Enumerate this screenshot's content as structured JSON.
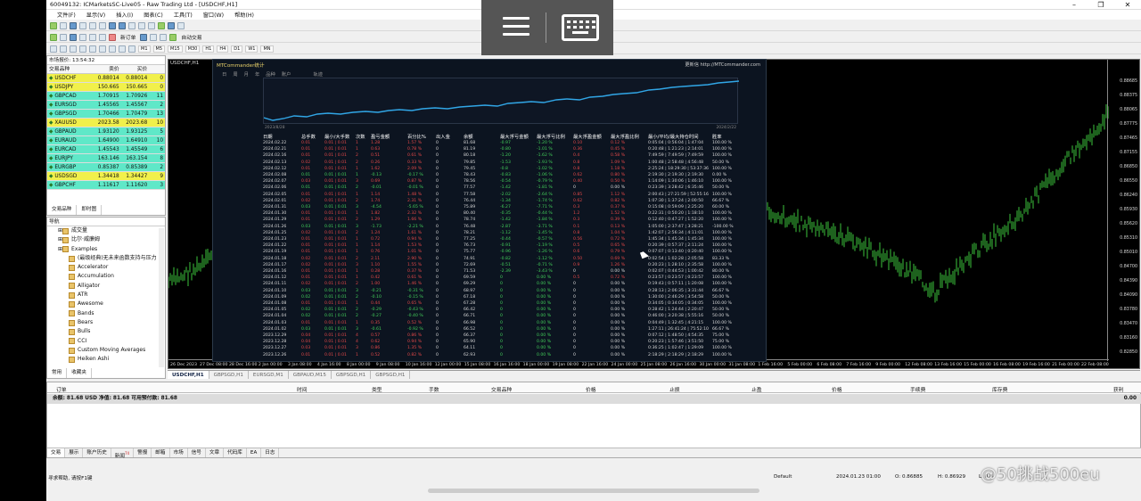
{
  "window": {
    "title": "60049132: ICMarketsSC-Live05 - Raw Trading Ltd - [USDCHF,H1]",
    "controls": [
      "–",
      "❐",
      "✕"
    ]
  },
  "menu": [
    "文件(F)",
    "显示(V)",
    "插入(I)",
    "图表(C)",
    "工具(T)",
    "窗口(W)",
    "帮助(H)"
  ],
  "toolbar": {
    "new_order": "新订单",
    "auto_trading": "自动交易",
    "timeframes": [
      "M1",
      "M5",
      "M15",
      "M30",
      "H1",
      "H4",
      "D1",
      "W1",
      "MN"
    ]
  },
  "market_watch": {
    "header": "市场报价: 13:54:32",
    "columns": [
      "交易品种",
      "卖价",
      "买价",
      ""
    ],
    "rows": [
      {
        "symbol": "USDCHF",
        "bid": "0.88014",
        "ask": "0.88014",
        "spread": "0",
        "color": "#f1f04b"
      },
      {
        "symbol": "USDJPY",
        "bid": "150.665",
        "ask": "150.665",
        "spread": "0",
        "color": "#f1f04b"
      },
      {
        "symbol": "GBPCAD",
        "bid": "1.70915",
        "ask": "1.70926",
        "spread": "11",
        "color": "#5fe8c8"
      },
      {
        "symbol": "EURSGD",
        "bid": "1.45565",
        "ask": "1.45567",
        "spread": "2",
        "color": "#5fe8c8"
      },
      {
        "symbol": "GBPSGD",
        "bid": "1.70466",
        "ask": "1.70479",
        "spread": "13",
        "color": "#5fe8c8"
      },
      {
        "symbol": "XAUUSD",
        "bid": "2023.58",
        "ask": "2023.68",
        "spread": "10",
        "color": "#f1f04b"
      },
      {
        "symbol": "GBPAUD",
        "bid": "1.93120",
        "ask": "1.93125",
        "spread": "5",
        "color": "#5fe8c8"
      },
      {
        "symbol": "EURAUD",
        "bid": "1.64900",
        "ask": "1.64910",
        "spread": "10",
        "color": "#5fe8c8"
      },
      {
        "symbol": "EURCAD",
        "bid": "1.45543",
        "ask": "1.45549",
        "spread": "6",
        "color": "#5fe8c8"
      },
      {
        "symbol": "EURJPY",
        "bid": "163.146",
        "ask": "163.154",
        "spread": "8",
        "color": "#5fe8c8"
      },
      {
        "symbol": "EURGBP",
        "bid": "0.85387",
        "ask": "0.85389",
        "spread": "2",
        "color": "#5fe8c8"
      },
      {
        "symbol": "USDSGD",
        "bid": "1.34418",
        "ask": "1.34427",
        "spread": "9",
        "color": "#f1f04b"
      },
      {
        "symbol": "GBPCHF",
        "bid": "1.11617",
        "ask": "1.11620",
        "spread": "3",
        "color": "#5fe8c8"
      }
    ],
    "tabs": [
      "交易品种",
      "即时图"
    ]
  },
  "navigator": {
    "header": "导航",
    "items": [
      "成交量",
      "比尔·威廉姆",
      "Examples",
      "(最级经典)无未来函数支持与压力",
      "Accelerator",
      "Accumulation",
      "Alligator",
      "ATR",
      "Awesome",
      "Bands",
      "Bears",
      "Bulls",
      "CCI",
      "Custom Moving Averages",
      "Heiken Ashi"
    ],
    "tabs": [
      "常用",
      "收藏夹"
    ]
  },
  "chart": {
    "tag": "USDCHF,H1",
    "y_labels": [
      "0.88685",
      "0.88375",
      "0.88065",
      "0.87775",
      "0.87465",
      "0.87155",
      "0.86850",
      "0.86550",
      "0.86240",
      "0.85930",
      "0.85620",
      "0.85310",
      "0.85010",
      "0.84700",
      "0.84390",
      "0.84090",
      "0.83780",
      "0.83470",
      "0.83160",
      "0.82850"
    ],
    "x_labels": [
      "26 Dec 2023",
      "27 Dec 08:00",
      "28 Dec 16:00",
      "2 Jan 00:00",
      "3 Jan 08:00",
      "4 Jan 16:00",
      "8 Jan 00:00",
      "9 Jan 08:00",
      "10 Jan 16:00",
      "12 Jan 00:00",
      "15 Jan 08:00",
      "16 Jan 16:00",
      "18 Jan 00:00",
      "19 Jan 08:00",
      "22 Jan 16:00",
      "24 Jan 00:00",
      "25 Jan 08:00",
      "26 Jan 16:00",
      "30 Jan 00:00",
      "31 Jan 08:00",
      "1 Feb 16:00",
      "5 Feb 00:00",
      "6 Feb 08:00",
      "7 Feb 16:00",
      "9 Feb 00:00",
      "12 Feb 08:00",
      "13 Feb 16:00",
      "15 Feb 00:00",
      "16 Feb 08:00",
      "19 Feb 16:00",
      "21 Feb 00:00",
      "22 Feb 08:00"
    ]
  },
  "stats": {
    "title": "MTCommander统计",
    "link": "更新信 http://MTCommander.com",
    "menu": [
      "日",
      "周",
      "月",
      "年",
      "品种",
      "账户",
      "轨迹"
    ],
    "chart_start": "2023/8/28",
    "chart_end": "2024/2/22",
    "headers": [
      "日期",
      "总手数",
      "最小/大手数",
      "次数",
      "盈亏金额",
      "百分比%",
      "出入金",
      "余额",
      "最大浮亏金额",
      "最大浮亏比例",
      "最大浮盈金额",
      "最大浮盈比例",
      "最小/平均/最大持仓时间",
      "胜率"
    ],
    "rows": [
      [
        "2024.02.22",
        "0.01",
        "0.01 | 0.01",
        "1",
        "1.28",
        "1.57 %",
        "0",
        "81.68",
        "-0.97",
        "-1.20 %",
        "0.10",
        "0.12 %",
        "0:05:04 | 0:56:04 | 1:47:04",
        "100.00 %"
      ],
      [
        "2024.02.21",
        "0.01",
        "0.01 | 0.01",
        "1",
        "0.63",
        "0.78 %",
        "0",
        "81.19",
        "-0.80",
        "-1.01 %",
        "0.36",
        "0.45 %",
        "0:20:48 | 1:21:23 | 2:14:01",
        "100.00 %"
      ],
      [
        "2024.02.16",
        "0.01",
        "0.01 | 0.01",
        "2",
        "0.51",
        "0.61 %",
        "0",
        "80.18",
        "-1.20",
        "-1.62 %",
        "0.4",
        "0.58 %",
        "7:49:59 | 7:49:59 | 7:49:59",
        "100.00 %"
      ],
      [
        "2024.02.13",
        "0.02",
        "0.01 | 0.01",
        "2",
        "0.26",
        "0.33 %",
        "0",
        "79.85",
        "-1.53",
        "-1.93 %",
        "0.8",
        "1.09 %",
        "1:00:48 | 2:58:48 | 4:56:48",
        "50.00 %"
      ],
      [
        "2024.02.12",
        "0.01",
        "0.01 | 0.01",
        "1",
        "1.62",
        "2.09 %",
        "0",
        "79.45",
        "-0.8",
        "-1.02 %",
        "0.8",
        "1.18 %",
        "2:25:24 | 18:29:30 | 53:37:36",
        "100.00 %"
      ],
      [
        "2024.02.08",
        "0.01",
        "0.01 | 0.01",
        "1",
        "-0.13",
        "-0.17 %",
        "0",
        "78.43",
        "-0.83",
        "-1.06 %",
        "0.62",
        "0.80 %",
        "2:19:30 | 2:19:30 | 2:19:30",
        "0.00 %"
      ],
      [
        "2024.02.07",
        "0.03",
        "0.01 | 0.01",
        "3",
        "0.69",
        "0.87 %",
        "0",
        "78.56",
        "-0.54",
        "-0.79 %",
        "0.40",
        "0.50 %",
        "1:14:09 | 1:30:06 | 1:46:10",
        "100.00 %"
      ],
      [
        "2024.02.06",
        "0.01",
        "0.01 | 0.01",
        "2",
        "-0.01",
        "-0.01 %",
        "0",
        "77.57",
        "-1.42",
        "-1.81 %",
        "0",
        "0.00 %",
        "0:23:39 | 3:28:42 | 6:35:46",
        "50.00 %"
      ],
      [
        "2024.02.05",
        "0.01",
        "0.01 | 0.01",
        "1",
        "1.14",
        "1.48 %",
        "0",
        "77.58",
        "-2.02",
        "-2.64 %",
        "0.85",
        "1.12 %",
        "2:00:43 | 27:21:59 | 52:55:16",
        "100.00 %"
      ],
      [
        "2024.02.01",
        "0.02",
        "0.01 | 0.01",
        "2",
        "1.74",
        "2.31 %",
        "0",
        "76.44",
        "-1.34",
        "-1.74 %",
        "0.62",
        "0.82 %",
        "1:07:30 | 1:37:24 | 2:00:50",
        "66.67 %"
      ],
      [
        "2024.01.31",
        "0.03",
        "0.01 | 0.01",
        "3",
        "-4.54",
        "-5.65 %",
        "0",
        "75.89",
        "-6.27",
        "-7.71 %",
        "0.3",
        "0.37 %",
        "0:15:08 | 0:59:09 | 2:25:20",
        "60.00 %"
      ],
      [
        "2024.01.30",
        "0.01",
        "0.01 | 0.01",
        "1",
        "1.82",
        "2.32 %",
        "0",
        "80.40",
        "-0.35",
        "-0.44 %",
        "1.2",
        "1.52 %",
        "0:22:31 | 0:50:20 | 1:18:10",
        "100.00 %"
      ],
      [
        "2024.01.29",
        "0.01",
        "0.01 | 0.01",
        "2",
        "1.29",
        "1.66 %",
        "0",
        "78.74",
        "-1.42",
        "-1.84 %",
        "0.3",
        "0.39 %",
        "0:12:40 | 0:47:27 | 1:52:20",
        "100.00 %"
      ],
      [
        "2024.01.26",
        "0.03",
        "0.01 | 0.01",
        "3",
        "-1.73",
        "-2.21 %",
        "0",
        "76.48",
        "-2.87",
        "-3.71 %",
        "0.1",
        "0.13 %",
        "1:05:00 | 2:37:47 | 3:28:21",
        "-100.00 %"
      ],
      [
        "2024.01.25",
        "0.02",
        "0.01 | 0.01",
        "2",
        "1.24",
        "1.61 %",
        "0",
        "78.21",
        "-1.12",
        "-1.45 %",
        "0.8",
        "1.04 %",
        "1:42:07 | 2:56:34 | 4:11:01",
        "100.00 %"
      ],
      [
        "2024.01.23",
        "0.01",
        "0.01 | 0.01",
        "1",
        "0.72",
        "0.94 %",
        "0",
        "77.25",
        "-0.44",
        "-0.57 %",
        "0.56",
        "0.72 %",
        "1:45:34 | 1:45:34 | 1:45:34",
        "100.00 %"
      ],
      [
        "2024.01.22",
        "0.01",
        "0.01 | 0.01",
        "1",
        "1.14",
        "1.53 %",
        "0",
        "76.73",
        "-0.91",
        "-1.19 %",
        "0.5",
        "0.65 %",
        "0:20:39 | 0:57:37 | 2:11:24",
        "100.00 %"
      ],
      [
        "2024.01.19",
        "0.01",
        "0.01 | 0.01",
        "1",
        "0.76",
        "1.01 %",
        "0",
        "75.77",
        "-0.96",
        "-1.26 %",
        "0.6",
        "0.79 %",
        "0:07:07 | 0:13:40 | 0:20:40",
        "100.00 %"
      ],
      [
        "2024.01.18",
        "0.02",
        "0.01 | 0.01",
        "2",
        "2.11",
        "2.90 %",
        "0",
        "74.91",
        "-0.82",
        "-1.12 %",
        "0.50",
        "0.69 %",
        "0:02:54 | 1:02:28 | 2:05:58",
        "83.33 %"
      ],
      [
        "2024.01.17",
        "0.02",
        "0.01 | 0.01",
        "3",
        "1.10",
        "1.55 %",
        "0",
        "72.69",
        "-0.51",
        "-0.71 %",
        "0.9",
        "1.26 %",
        "0:20:23 | 1:28:10 | 2:35:58",
        "100.00 %"
      ],
      [
        "2024.01.16",
        "0.01",
        "0.01 | 0.01",
        "1",
        "0.28",
        "0.37 %",
        "0",
        "71.53",
        "-2.39",
        "-3.43 %",
        "0",
        "0.00 %",
        "0:02:07 | 0:44:53 | 1:00:42",
        "80.00 %"
      ],
      [
        "2024.01.12",
        "0.01",
        "0.01 | 0.01",
        "1",
        "0.42",
        "0.61 %",
        "0",
        "69.59",
        "0",
        "0.00 %",
        "0.5",
        "0.72 %",
        "0:23:57 | 0:23:57 | 0:23:57",
        "100.00 %"
      ],
      [
        "2024.01.11",
        "0.02",
        "0.01 | 0.01",
        "2",
        "1.00",
        "1.46 %",
        "0",
        "69.29",
        "0",
        "0.00 %",
        "0",
        "0.00 %",
        "0:19:43 | 0:57:11 | 1:20:08",
        "100.00 %"
      ],
      [
        "2024.01.10",
        "0.03",
        "0.01 | 0.01",
        "3",
        "-0.21",
        "-0.31 %",
        "0",
        "68.97",
        "0",
        "0.00 %",
        "0",
        "0.00 %",
        "0:28:13 | 2:06:35 | 3:31:44",
        "66.67 %"
      ],
      [
        "2024.01.09",
        "0.02",
        "0.01 | 0.01",
        "2",
        "-0.10",
        "-0.15 %",
        "0",
        "67.18",
        "0",
        "0.00 %",
        "0",
        "0.00 %",
        "1:30:00 | 2:46:29 | 3:54:58",
        "50.00 %"
      ],
      [
        "2024.01.08",
        "0.01",
        "0.01 | 0.01",
        "1",
        "0.44",
        "0.65 %",
        "0",
        "67.28",
        "0",
        "0.00 %",
        "0",
        "0.00 %",
        "0:34:05 | 0:34:05 | 0:34:05",
        "100.00 %"
      ],
      [
        "2024.01.05",
        "0.02",
        "0.01 | 0.01",
        "2",
        "-0.29",
        "-0.43 %",
        "0",
        "66.42",
        "0",
        "0.00 %",
        "0",
        "0.00 %",
        "0:28:42 | 1:24:44 | 2:20:47",
        "50.00 %"
      ],
      [
        "2024.01.04",
        "0.02",
        "0.01 | 0.01",
        "2",
        "-0.27",
        "-0.40 %",
        "0",
        "66.71",
        "0",
        "0.00 %",
        "0",
        "0.00 %",
        "0:46:00 | 3:20:38 | 5:55:16",
        "50.00 %"
      ],
      [
        "2024.01.03",
        "0.01",
        "0.01 | 0.01",
        "1",
        "0.35",
        "0.52 %",
        "0",
        "66.98",
        "0",
        "0.00 %",
        "0",
        "0.00 %",
        "0:04:49 | 1:32:45 | 4:21:15",
        "100.00 %"
      ],
      [
        "2024.01.02",
        "0.03",
        "0.01 | 0.01",
        "3",
        "-0.61",
        "-0.92 %",
        "0",
        "66.52",
        "0",
        "0.00 %",
        "0",
        "0.00 %",
        "1:27:11 | 26:41:24 | 75:52:10",
        "66.67 %"
      ],
      [
        "2023.12.29",
        "0.04",
        "0.01 | 0.01",
        "4",
        "0.57",
        "0.86 %",
        "0",
        "66.37",
        "0",
        "0.00 %",
        "0",
        "0.00 %",
        "0:07:12 | 1:48:50 | 4:54:35",
        "75.00 %"
      ],
      [
        "2023.12.28",
        "0.04",
        "0.01 | 0.01",
        "4",
        "0.62",
        "0.94 %",
        "0",
        "65.90",
        "0",
        "0.00 %",
        "0",
        "0.00 %",
        "0:20:23 | 1:57:46 | 3:51:50",
        "75.00 %"
      ],
      [
        "2023.12.27",
        "0.03",
        "0.01 | 0.01",
        "3",
        "0.86",
        "1.35 %",
        "0",
        "64.11",
        "0",
        "0.00 %",
        "0",
        "0.00 %",
        "0:36:25 | 1:02:47 | 1:29:09",
        "100.00 %"
      ],
      [
        "2023.12.26",
        "0.01",
        "0.01 | 0.01",
        "1",
        "0.52",
        "0.82 %",
        "0",
        "62.93",
        "0",
        "0.00 %",
        "0",
        "0.00 %",
        "2:18:29 | 2:18:29 | 2:18:29",
        "100.00 %"
      ]
    ]
  },
  "chart_tabs": [
    "USDCHF,H1",
    "GBPSGD,H1",
    "EURSGD,M1",
    "GBPAUD,M15",
    "GBPSGD,H1",
    "GBPSGD,H1"
  ],
  "terminal": {
    "columns": [
      "订单",
      "时间",
      "类型",
      "手数",
      "交易品种",
      "价格",
      "止损",
      "止盈",
      "价格",
      "手续费",
      "库存费",
      "获利"
    ],
    "balance_line": "余额: 81.68 USD  净值: 81.68  可用预付款: 81.68",
    "balance_value": "0.00",
    "tabs": [
      "交易",
      "展示",
      "账户历史",
      "新闻",
      "警报",
      "邮箱",
      "市场",
      "信号",
      "文章",
      "代码库",
      "EA",
      "日志"
    ],
    "news_badge": "74"
  },
  "statusbar": {
    "help": "寻求帮助, 请按F1键",
    "profile": "Default",
    "time": "2024.01.23 01:00",
    "open": "O: 0.86885",
    "high": "H: 0.86929",
    "low": "L: 0.8"
  },
  "watermark": "@50挑战500eu"
}
